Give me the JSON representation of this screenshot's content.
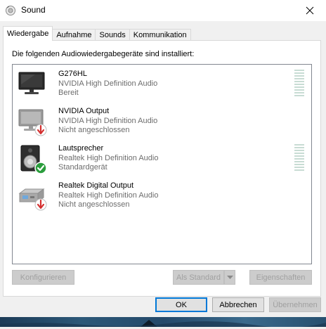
{
  "window": {
    "title": "Sound"
  },
  "tabs": [
    {
      "label": "Wiedergabe",
      "active": true
    },
    {
      "label": "Aufnahme",
      "active": false
    },
    {
      "label": "Sounds",
      "active": false
    },
    {
      "label": "Kommunikation",
      "active": false
    }
  ],
  "panel": {
    "heading": "Die folgenden Audiowiedergabegeräte sind installiert:"
  },
  "devices": [
    {
      "name": "G276HL",
      "driver": "NVIDIA High Definition Audio",
      "status": "Bereit",
      "icon": "monitor-icon",
      "badge": null,
      "level_meter": true
    },
    {
      "name": "NVIDIA Output",
      "driver": "NVIDIA High Definition Audio",
      "status": "Nicht angeschlossen",
      "icon": "monitor-icon",
      "badge": "unplugged-badge-icon",
      "level_meter": false
    },
    {
      "name": "Lautsprecher",
      "driver": "Realtek High Definition Audio",
      "status": "Standardgerät",
      "icon": "speaker-icon",
      "badge": "default-check-badge-icon",
      "level_meter": true
    },
    {
      "name": "Realtek Digital Output",
      "driver": "Realtek High Definition Audio",
      "status": "Nicht angeschlossen",
      "icon": "digital-output-icon",
      "badge": "unplugged-badge-icon",
      "level_meter": false
    }
  ],
  "buttons": {
    "configure": "Konfigurieren",
    "set_default": "Als Standard",
    "properties": "Eigenschaften",
    "ok": "OK",
    "cancel": "Abbrechen",
    "apply": "Übernehmen"
  },
  "colors": {
    "accent": "#0078d7",
    "default_check": "#2a9d3c",
    "unplugged": "#d32f2f",
    "level_meter": "#c8dcd4"
  }
}
